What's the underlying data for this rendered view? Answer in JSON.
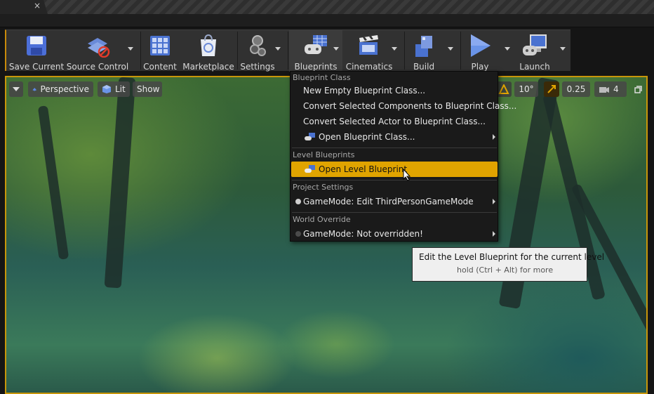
{
  "titlebar": {
    "tab_close": "×"
  },
  "toolbar": {
    "items": [
      {
        "label": "Save Current",
        "icon": "save-icon"
      },
      {
        "label": "Source Control",
        "icon": "source-control-icon"
      },
      {
        "label": "Content",
        "icon": "content-icon"
      },
      {
        "label": "Marketplace",
        "icon": "marketplace-icon"
      },
      {
        "label": "Settings",
        "icon": "settings-icon"
      },
      {
        "label": "Blueprints",
        "icon": "blueprints-icon"
      },
      {
        "label": "Cinematics",
        "icon": "cinematics-icon"
      },
      {
        "label": "Build",
        "icon": "build-icon"
      },
      {
        "label": "Play",
        "icon": "play-icon"
      },
      {
        "label": "Launch",
        "icon": "launch-icon"
      }
    ]
  },
  "viewport": {
    "perspective_label": "Perspective",
    "lit_label": "Lit",
    "show_label": "Show",
    "rotation_snap": "10°",
    "scale_snap": "0.25",
    "camera_speed": "4"
  },
  "menu": {
    "sections": [
      {
        "header": "Blueprint Class",
        "items": [
          {
            "label": "New Empty Blueprint Class..."
          },
          {
            "label": "Convert Selected Components to Blueprint Class..."
          },
          {
            "label": "Convert Selected Actor to Blueprint Class..."
          },
          {
            "label": "Open Blueprint Class...",
            "icon": "open-blueprint-icon",
            "submenu": true
          }
        ]
      },
      {
        "header": "Level Blueprints",
        "items": [
          {
            "label": "Open Level Blueprint",
            "icon": "level-blueprint-icon",
            "highlighted": true
          }
        ]
      },
      {
        "header": "Project Settings",
        "items": [
          {
            "label": "GameMode: Edit ThirdPersonGameMode",
            "submenu": true
          }
        ]
      },
      {
        "header": "World Override",
        "items": [
          {
            "label": "GameMode: Not overridden!",
            "submenu": true
          }
        ]
      }
    ]
  },
  "tooltip": {
    "main": "Edit the Level Blueprint for the current level",
    "sub": "hold (Ctrl + Alt) for more"
  },
  "colors": {
    "accent": "#e0a400",
    "viewport_border": "#c8960a",
    "menu_bg": "#1a1a1a"
  }
}
